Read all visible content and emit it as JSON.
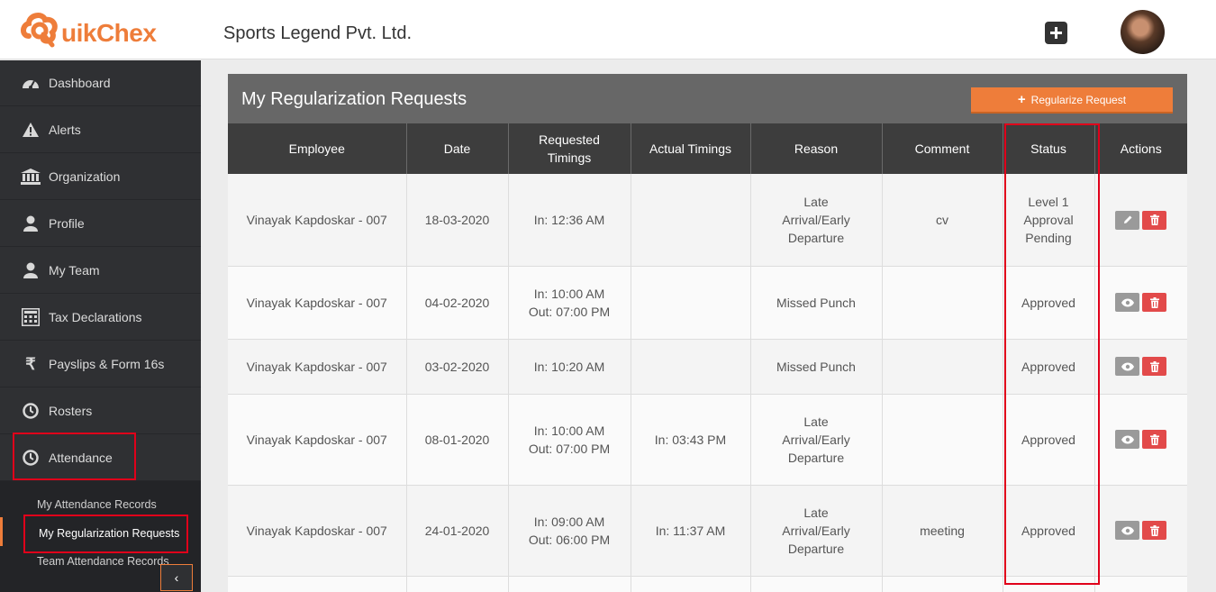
{
  "header": {
    "logo_text": "uikChex",
    "company": "Sports Legend Pvt. Ltd."
  },
  "sidebar": {
    "items": [
      {
        "label": "Dashboard",
        "icon": "dashboard-icon"
      },
      {
        "label": "Alerts",
        "icon": "warning-icon"
      },
      {
        "label": "Organization",
        "icon": "bank-icon"
      },
      {
        "label": "Profile",
        "icon": "user-icon"
      },
      {
        "label": "My Team",
        "icon": "team-icon"
      },
      {
        "label": "Tax Declarations",
        "icon": "calculator-icon"
      },
      {
        "label": "Payslips & Form 16s",
        "icon": "rupee-icon"
      },
      {
        "label": "Rosters",
        "icon": "clock-icon"
      },
      {
        "label": "Attendance",
        "icon": "clock-icon"
      }
    ],
    "sub_items": [
      {
        "label": "My Attendance Records"
      },
      {
        "label": "My Regularization Requests"
      },
      {
        "label": "Team Attendance Records"
      }
    ]
  },
  "panel": {
    "title": "My Regularization Requests",
    "button_label": "Regularize Request"
  },
  "table": {
    "headers": [
      "Employee",
      "Date",
      "Requested Timings",
      "Actual Timings",
      "Reason",
      "Comment",
      "Status",
      "Actions"
    ],
    "rows": [
      {
        "employee": "Vinayak Kapdoskar - 007",
        "date": "18-03-2020",
        "requested": "In: 12:36 AM",
        "actual": "",
        "reason": "Late Arrival/Early Departure",
        "comment": "cv",
        "status": "Level 1 Approval Pending",
        "action": "edit"
      },
      {
        "employee": "Vinayak Kapdoskar - 007",
        "date": "04-02-2020",
        "requested": "In: 10:00 AM Out: 07:00 PM",
        "actual": "",
        "reason": "Missed Punch",
        "comment": "",
        "status": "Approved",
        "action": "view"
      },
      {
        "employee": "Vinayak Kapdoskar - 007",
        "date": "03-02-2020",
        "requested": "In: 10:20 AM",
        "actual": "",
        "reason": "Missed Punch",
        "comment": "",
        "status": "Approved",
        "action": "view"
      },
      {
        "employee": "Vinayak Kapdoskar - 007",
        "date": "08-01-2020",
        "requested": "In: 10:00 AM Out: 07:00 PM",
        "actual": "In: 03:43 PM",
        "reason": "Late Arrival/Early Departure",
        "comment": "",
        "status": "Approved",
        "action": "view"
      },
      {
        "employee": "Vinayak Kapdoskar - 007",
        "date": "24-01-2020",
        "requested": "In: 09:00 AM Out: 06:00 PM",
        "actual": "In: 11:37 AM",
        "reason": "Late Arrival/Early Departure",
        "comment": "meeting",
        "status": "Approved",
        "action": "view"
      }
    ]
  },
  "colors": {
    "accent": "#ee7d3a",
    "sidebar": "#2f3033",
    "table_header": "#3d3d3d",
    "panel_header": "#676767",
    "danger": "#e24a4a",
    "highlight_box": "#e0001a"
  }
}
